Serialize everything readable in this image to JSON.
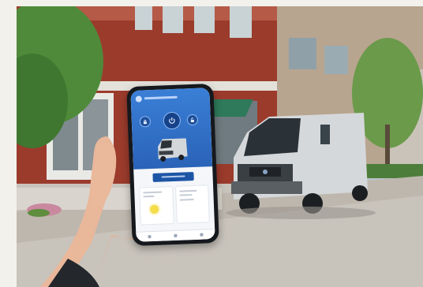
{
  "photo": {
    "description_colors": {
      "sky": "#e9eef0",
      "brick": "#9b3b2c",
      "van": "#d7dadc",
      "road": "#bdb9b3",
      "tree": "#4f8a3a",
      "app_blue": "#2a63b8"
    }
  },
  "phone_app": {
    "icons": [
      "lock-icon",
      "start-icon",
      "unlock-icon",
      "van-thumbnail",
      "sun-icon"
    ]
  }
}
